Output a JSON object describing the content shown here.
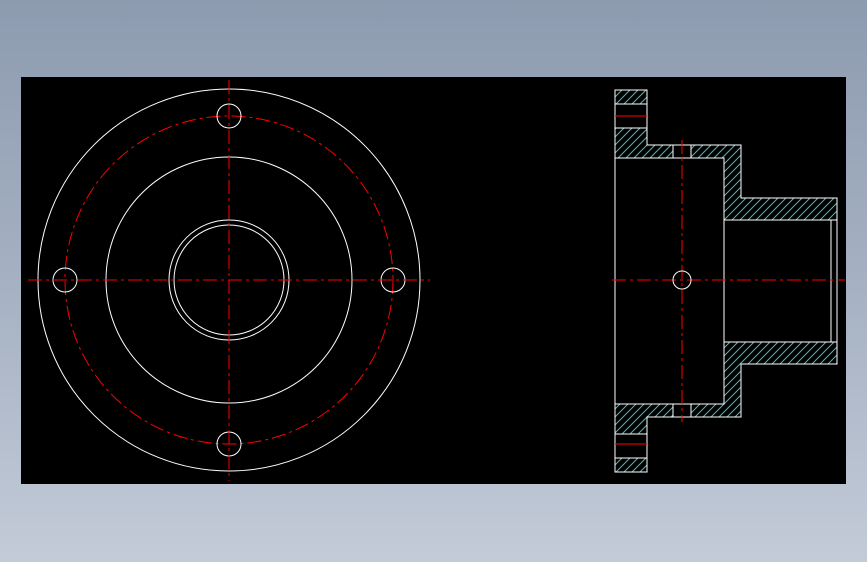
{
  "drawing": {
    "background": "#000000",
    "outline_color": "#ffffff",
    "centerline_color": "#ff0000",
    "hatch_color": "#4fb7b7",
    "views": [
      "front-view",
      "section-view"
    ]
  }
}
